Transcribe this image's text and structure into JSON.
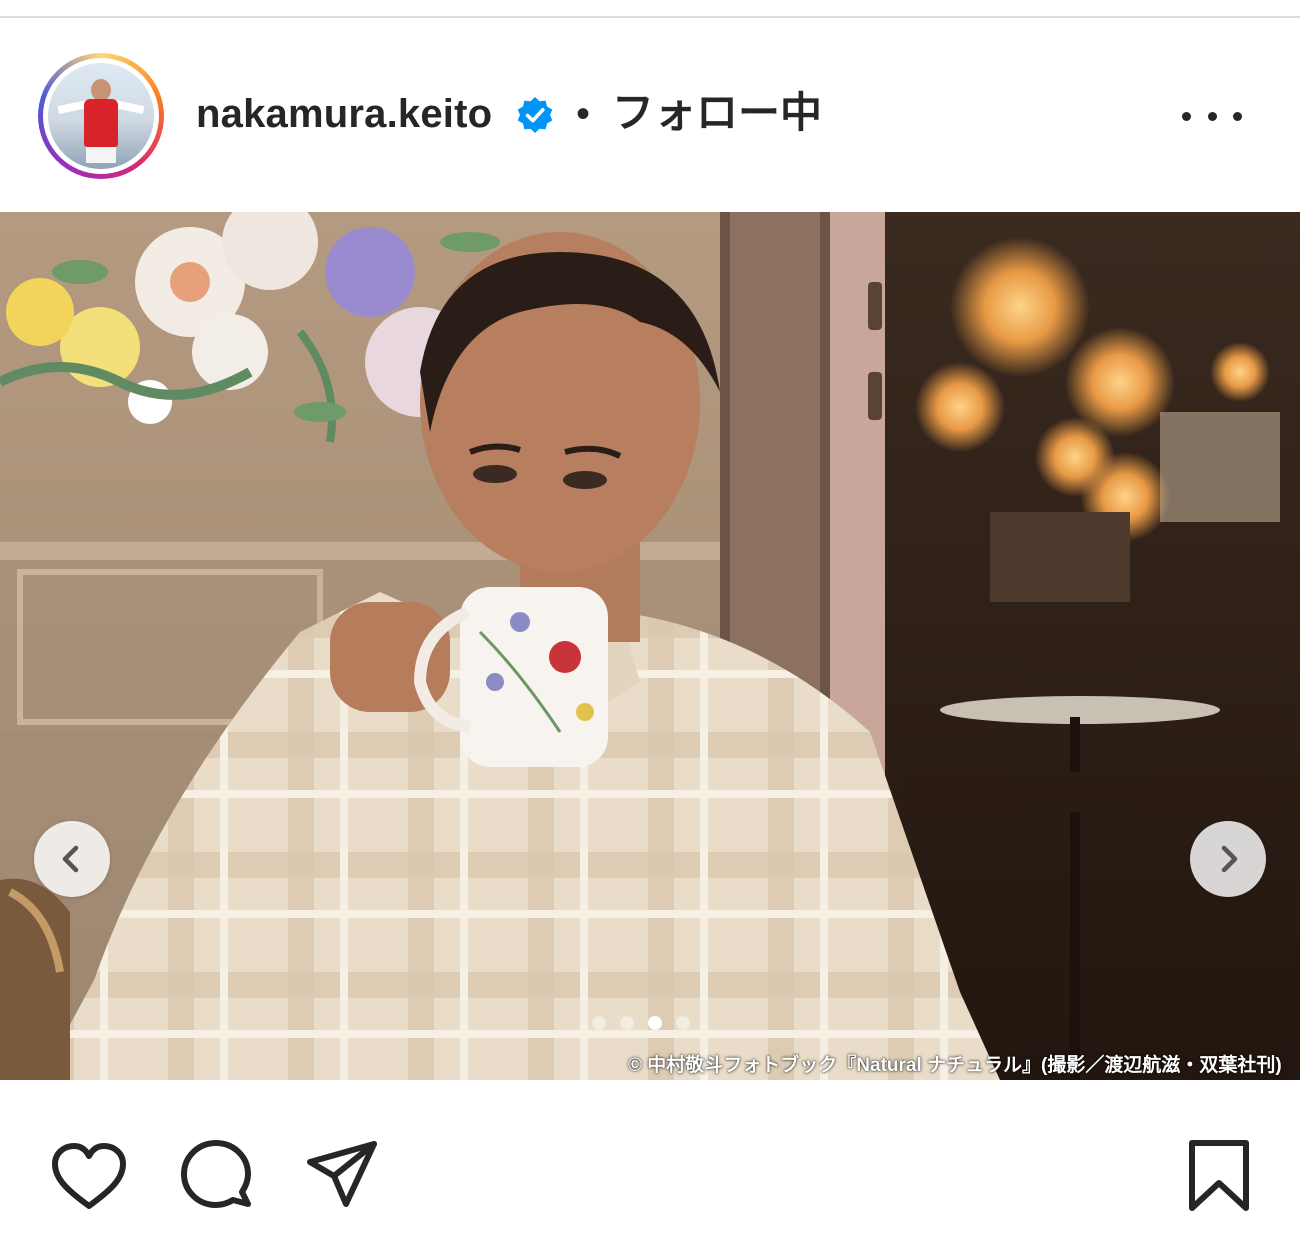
{
  "post": {
    "username": "nakamura.keito",
    "separator": "•",
    "follow_status": "フォロー中",
    "more_icon": "more-horizontal-icon",
    "verified_icon": "verified-badge-icon"
  },
  "media": {
    "credit": "© 中村敬斗フォトブック『Natural ナチュラル』(撮影／渡辺航滋・双葉社刊)",
    "carousel": {
      "total": 4,
      "active": 3
    }
  },
  "actions": {
    "like_icon": "heart-icon",
    "comment_icon": "comment-icon",
    "share_icon": "send-icon",
    "save_icon": "bookmark-icon"
  },
  "colors": {
    "verified": "#0095f6",
    "text": "#262626"
  }
}
